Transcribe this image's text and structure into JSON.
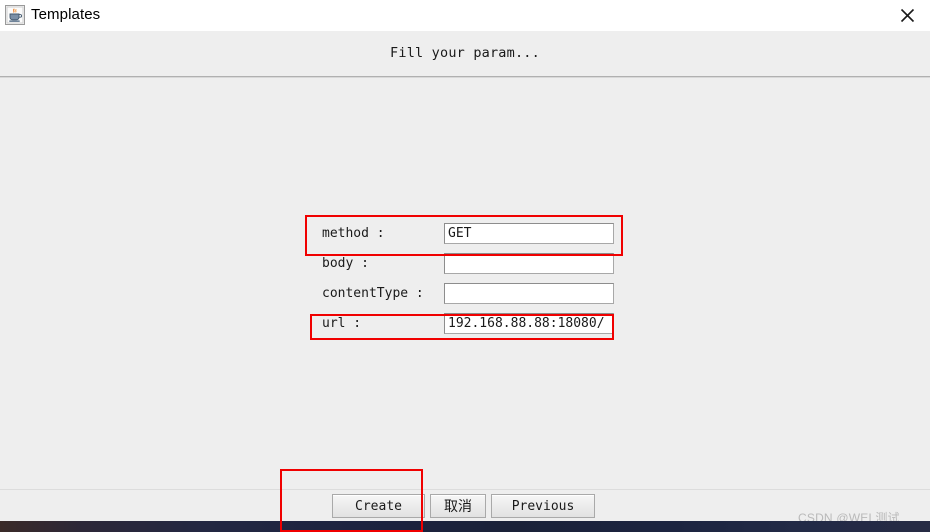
{
  "window": {
    "title": "Templates",
    "icon": "java-cup-icon",
    "close_label": "✕",
    "background_color": "#eeeeee"
  },
  "header": {
    "title": "Fill your param..."
  },
  "form": {
    "fields": [
      {
        "label": "method :",
        "value": "GET",
        "placeholder": ""
      },
      {
        "label": "body :",
        "value": "",
        "placeholder": ""
      },
      {
        "label": "contentType :",
        "value": "",
        "placeholder": ""
      },
      {
        "label": "url :",
        "value": "192.168.88.88:18080/",
        "placeholder": ""
      }
    ]
  },
  "footer": {
    "create_label": "Create",
    "cancel_label": "取消",
    "previous_label": "Previous"
  },
  "annotations": {
    "highlight_color": "#f00000",
    "boxes": [
      "method-row",
      "url-row",
      "create-button"
    ]
  },
  "watermark": {
    "text": "CSDN @WEL测试"
  }
}
